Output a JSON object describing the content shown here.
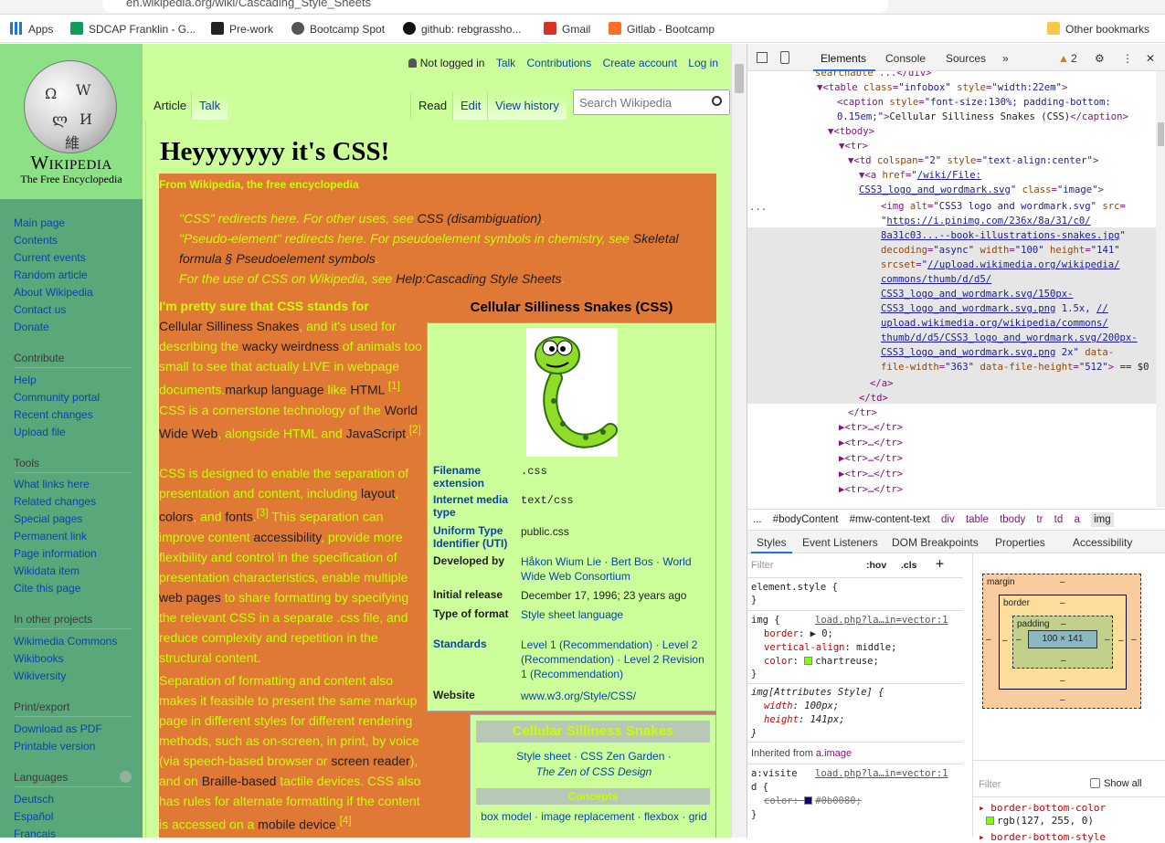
{
  "browser": {
    "url": "en.wikipedia.org/wiki/Cascading_Style_Sheets",
    "bookmarks": [
      "Apps",
      "SDCAP Franklin - G...",
      "Pre-work",
      "Bootcamp Spot",
      "github: rebgrassho...",
      "Gmail",
      "Gitlab - Bootcamp"
    ],
    "other_bookmarks": "Other bookmarks",
    "colors": {
      "accent": "#1a73e8"
    }
  },
  "wiki": {
    "logo": {
      "name": "Wikipedia",
      "tagline": "The Free Encyclopedia"
    },
    "personal": {
      "status": "Not logged in",
      "links": [
        "Talk",
        "Contributions",
        "Create account",
        "Log in"
      ]
    },
    "tabs_left": [
      "Article",
      "Talk"
    ],
    "tabs_right": [
      "Read",
      "Edit",
      "View history"
    ],
    "search_placeholder": "Search Wikipedia",
    "sidebar": {
      "main": [
        "Main page",
        "Contents",
        "Current events",
        "Random article",
        "About Wikipedia",
        "Contact us",
        "Donate"
      ],
      "contribute_heading": "Contribute",
      "contribute": [
        "Help",
        "Community portal",
        "Recent changes",
        "Upload file"
      ],
      "tools_heading": "Tools",
      "tools": [
        "What links here",
        "Related changes",
        "Special pages",
        "Permanent link",
        "Page information",
        "Wikidata item",
        "Cite this page"
      ],
      "projects_heading": "In other projects",
      "projects": [
        "Wikimedia Commons",
        "Wikibooks",
        "Wikiversity"
      ],
      "print_heading": "Print/export",
      "print": [
        "Download as PDF",
        "Printable version"
      ],
      "languages_heading": "Languages",
      "languages": [
        "Deutsch",
        "Español",
        "Français"
      ]
    },
    "title": "Heyyyyyyy it's CSS!",
    "from": "From Wikipedia, the free encyclopedia",
    "hatnotes": [
      {
        "pre": "\"CSS\" redirects here. For other uses, see ",
        "link": "CSS (disambiguation)",
        "post": "."
      },
      {
        "pre": "\"Pseudo-element\" redirects here. For pseudoelement symbols in chemistry, see ",
        "link": "Skeletal formula § Pseudoelement symbols",
        "post": "."
      },
      {
        "pre": "For the use of CSS on Wikipedia, see ",
        "link": "Help:Cascading Style Sheets",
        "post": "."
      }
    ],
    "infobox": {
      "caption": "Cellular Silliness Snakes (CSS)",
      "rows": [
        {
          "k": "Filename extension",
          "v": ".css",
          "link": true
        },
        {
          "k": "Internet media type",
          "v": "text/css",
          "link": true
        },
        {
          "k": "Uniform Type Identifier (UTI)",
          "v": "public.css",
          "link": true
        },
        {
          "k": "Developed by",
          "v": "Håkon Wium Lie · Bert Bos · World Wide Web Consortium"
        },
        {
          "k": "Initial release",
          "v": "December 17, 1996; 23 years ago"
        },
        {
          "k": "Type of format",
          "v": "Style sheet language"
        },
        {
          "k": "Standards",
          "v": "Level 1 (Recommendation) · Level 2 (Recommendation) · Level 2 Revision 1 (Recommendation)",
          "link": true
        },
        {
          "k": "Website",
          "v": "www.w3.org/Style/CSS/"
        }
      ]
    },
    "navbox": {
      "title": "Cellular Silliness Snakes",
      "line1": "Style sheet · CSS Zen Garden ·",
      "line2": "The Zen of CSS Design",
      "sub": "Concepts",
      "line3": "box model · image replacement · flexbox · grid"
    }
  },
  "devtools": {
    "tabs": [
      "Elements",
      "Console",
      "Sources"
    ],
    "warnings": "2",
    "breadcrumbs": [
      "...",
      "#bodyContent",
      "#mw-content-text",
      "div",
      "table",
      "tbody",
      "tr",
      "td",
      "a",
      "img"
    ],
    "subtabs": [
      "Styles",
      "Event Listeners",
      "DOM Breakpoints",
      "Properties",
      "Accessibility"
    ],
    "filter_placeholder": "Filter",
    "hov": ":hov",
    "cls": ".cls",
    "box": {
      "margin": "margin",
      "border": "border",
      "padding": "padding",
      "content": "100 × 141",
      "dash": "–"
    },
    "computed_filter": "Filter",
    "show_all": "Show all"
  }
}
